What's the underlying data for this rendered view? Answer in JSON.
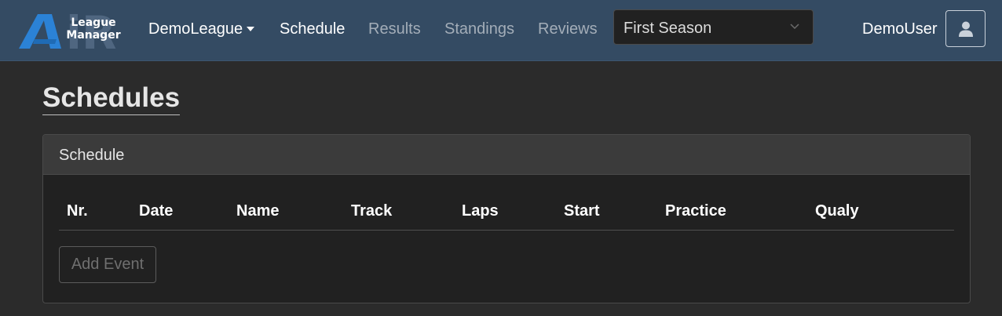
{
  "navbar": {
    "logo_mark": "iR",
    "logo_line1": "League",
    "logo_line2": "Manager",
    "league_label": "DemoLeague",
    "links": [
      "Schedule",
      "Results",
      "Standings",
      "Reviews"
    ],
    "season_selected": "First Season",
    "username": "DemoUser",
    "colors": {
      "bar": "#344b63",
      "logo_blue": "#2b82d6"
    }
  },
  "page": {
    "title": "Schedules"
  },
  "schedule_card": {
    "header": "Schedule",
    "columns": [
      "Nr.",
      "Date",
      "Name",
      "Track",
      "Laps",
      "Start",
      "Practice",
      "Qualy"
    ],
    "rows": [],
    "add_button": "Add Event"
  }
}
